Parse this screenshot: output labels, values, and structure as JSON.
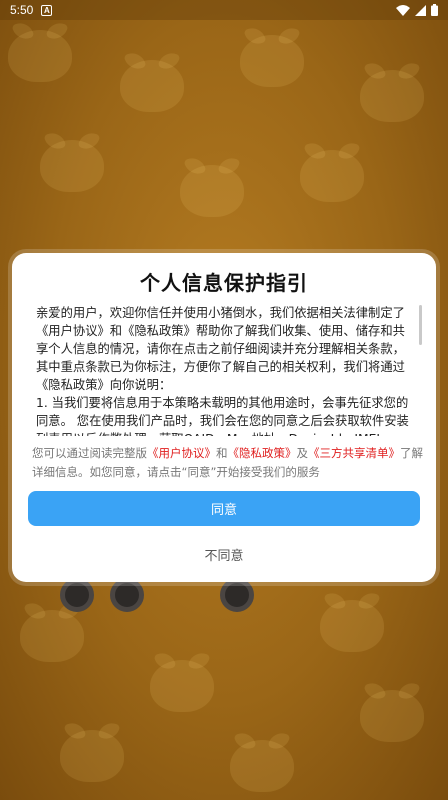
{
  "status_bar": {
    "time": "5:50",
    "notification_letter": "A"
  },
  "dialog": {
    "title": "个人信息保护指引",
    "policy_text": "亲爱的用户，欢迎你信任并使用小猪倒水，我们依据相关法律制定了《用户协议》和《隐私政策》帮助你了解我们收集、使用、储存和共享个人信息的情况，请你在点击之前仔细阅读并充分理解相关条款，其中重点条款已为你标注，方便你了解自己的相关权利，我们将通过《隐私政策》向你说明：\n1. 当我们要将信息用于本策略未载明的其他用途时，会事先征求您的同意。 您在使用我们产品时，我们会在您的同意之后会获取软件安装列表用以反作弊处理，获取OAID、Mac地址、DeviceId、IMEI、IMSI、",
    "notice": {
      "prefix": "您可以通过阅读完整版",
      "link_user_agreement": "《用户协议》",
      "and": "和",
      "link_privacy_policy": "《隐私政策》",
      "and2": "及",
      "link_third_party": "《三方共享清单》",
      "suffix": "了解详细信息。如您同意，请点击“同意”开始接受我们的服务"
    },
    "agree_label": "同意",
    "disagree_label": "不同意"
  },
  "colors": {
    "accent": "#3aa3f5",
    "link": "#e02020",
    "background": "#9a6617"
  }
}
